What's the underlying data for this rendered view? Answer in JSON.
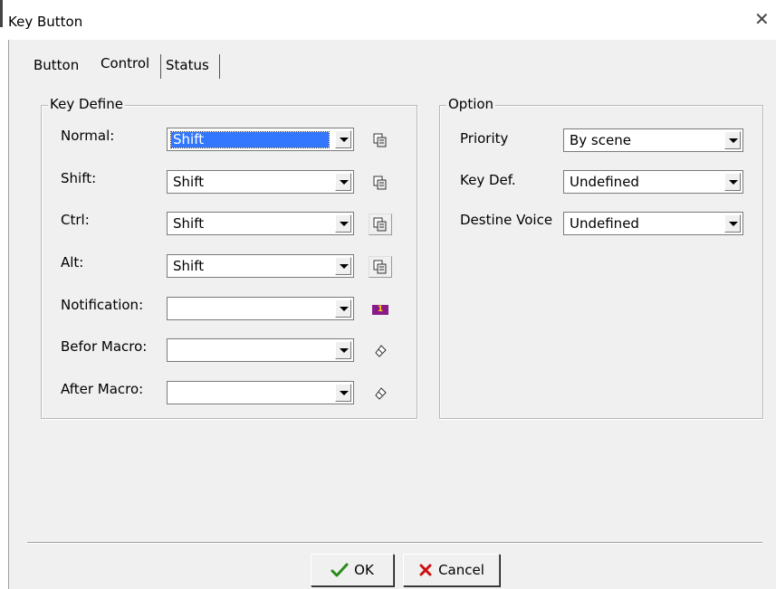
{
  "window": {
    "title": "Key Button",
    "close_glyph": "✕"
  },
  "tabs": [
    {
      "label": "Button"
    },
    {
      "label": "Control"
    },
    {
      "label": "Status"
    }
  ],
  "key_define": {
    "legend": "Key Define",
    "rows": [
      {
        "label": "Normal:",
        "value": "Shift",
        "selected": true,
        "icon": "copy-icon"
      },
      {
        "label": "Shift:",
        "value": "Shift",
        "icon": "copy-icon"
      },
      {
        "label": "Ctrl:",
        "value": "Shift",
        "icon": "copy-icon"
      },
      {
        "label": "Alt:",
        "value": "Shift",
        "icon": "copy-icon"
      },
      {
        "label": "Notification:",
        "value": "",
        "icon": "notification-icon",
        "icon_text": "1"
      },
      {
        "label": "Befor Macro:",
        "value": "",
        "icon": "eraser-icon"
      },
      {
        "label": "After Macro:",
        "value": "",
        "icon": "eraser-icon"
      }
    ]
  },
  "option": {
    "legend": "Option",
    "rows": [
      {
        "label": "Priority",
        "value": "By scene"
      },
      {
        "label": "Key Def.",
        "value": "Undefined"
      },
      {
        "label": "Destine Voice",
        "value": "Undefined"
      }
    ]
  },
  "buttons": {
    "ok_label": "OK",
    "cancel_label": "Cancel"
  },
  "colors": {
    "selection": "#3377ff",
    "ok_check": "#2a8a1a",
    "cancel_x": "#cc1111",
    "notification_badge": "#8a1a8a"
  }
}
